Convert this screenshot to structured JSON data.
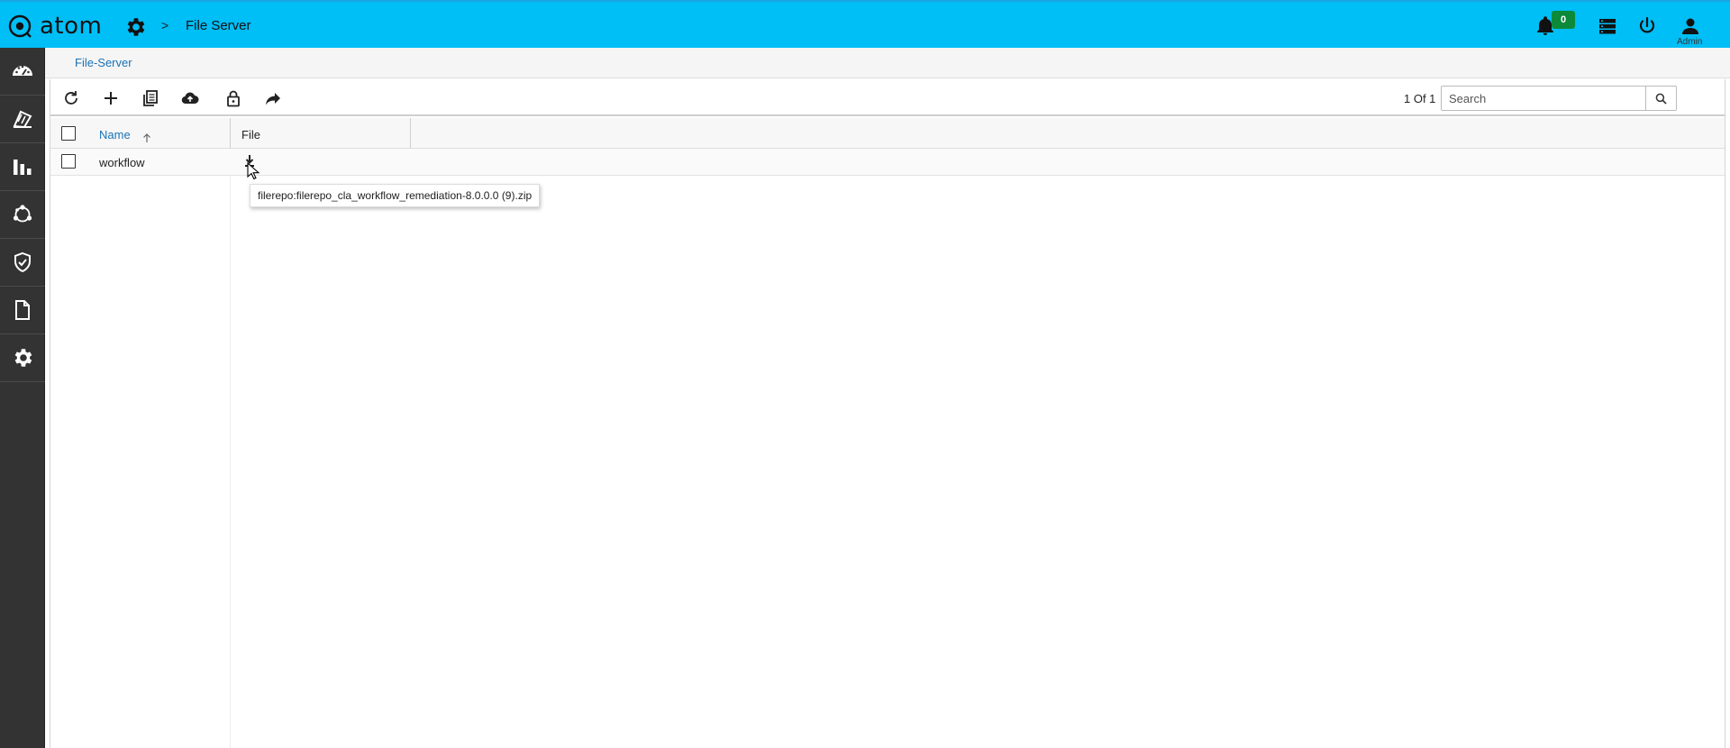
{
  "app": {
    "brand": "atom",
    "breadcrumb_title": "File Server",
    "breadcrumb_separator": ">",
    "notification_count": "0",
    "user_label": "Admin",
    "accent_color": "#00bef6",
    "sidebar_color": "#333333"
  },
  "sidebar": {
    "items": [
      {
        "icon": "dashboard-gauge-icon"
      },
      {
        "icon": "devices-icon"
      },
      {
        "icon": "bar-chart-icon"
      },
      {
        "icon": "network-topology-icon"
      },
      {
        "icon": "shield-check-icon"
      },
      {
        "icon": "document-icon"
      },
      {
        "icon": "settings-gear-icon"
      }
    ]
  },
  "subheader": {
    "link": "File-Server"
  },
  "toolbar": {
    "buttons": [
      "refresh-icon",
      "add-icon",
      "copy-icon",
      "cloud-upload-icon",
      "lock-icon",
      "share-forward-icon"
    ],
    "pager": "1 Of 1",
    "search_placeholder": "Search"
  },
  "grid": {
    "columns": [
      "Name",
      "File"
    ],
    "rows": [
      {
        "name": "workflow",
        "file": "filerepo:filerepo_cla_workflow_remediation-8.0.0.0 (9).zip"
      }
    ],
    "tooltip": "filerepo:filerepo_cla_workflow_remediation-8.0.0.0 (9).zip"
  }
}
